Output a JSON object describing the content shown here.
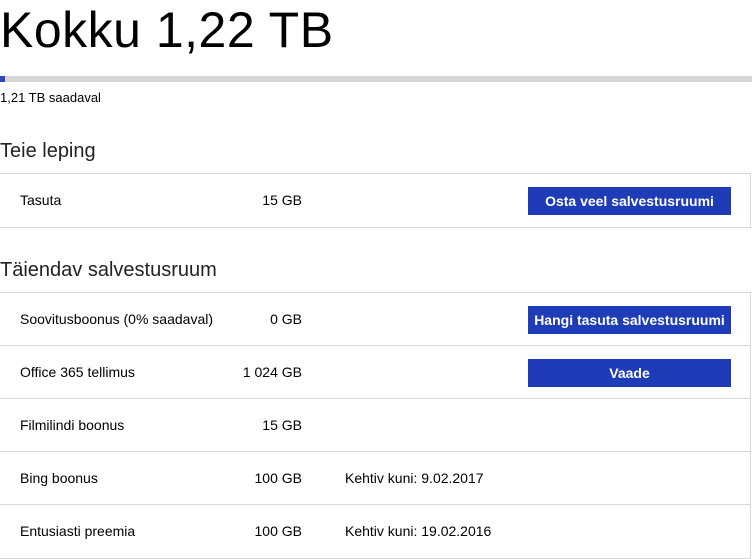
{
  "header": {
    "total_label": "Kokku 1,22 TB",
    "available_label": "1,21 TB saadaval",
    "usage_fraction": 0.007,
    "bar_color": "#2c47b6"
  },
  "plan": {
    "title": "Teie leping",
    "rows": [
      {
        "name": "Tasuta",
        "size": "15 GB",
        "note": "",
        "button": "Osta veel salvestusruumi"
      }
    ]
  },
  "extra": {
    "title": "Täiendav salvestusruum",
    "rows": [
      {
        "name": "Soovitusboonus (0% saadaval)",
        "size": "0 GB",
        "note": "",
        "button": "Hangi tasuta salvestusruumi"
      },
      {
        "name": "Office 365 tellimus",
        "size": "1 024 GB",
        "note": "",
        "button": "Vaade"
      },
      {
        "name": "Filmilindi boonus",
        "size": "15 GB",
        "note": "",
        "button": ""
      },
      {
        "name": "Bing boonus",
        "size": "100 GB",
        "note": "Kehtiv kuni: 9.02.2017",
        "button": ""
      },
      {
        "name": "Entusiasti preemia",
        "size": "100 GB",
        "note": "Kehtiv kuni: 19.02.2016",
        "button": ""
      }
    ]
  },
  "colors": {
    "accent": "#1e3bb8",
    "divider": "#d6d6d6"
  }
}
